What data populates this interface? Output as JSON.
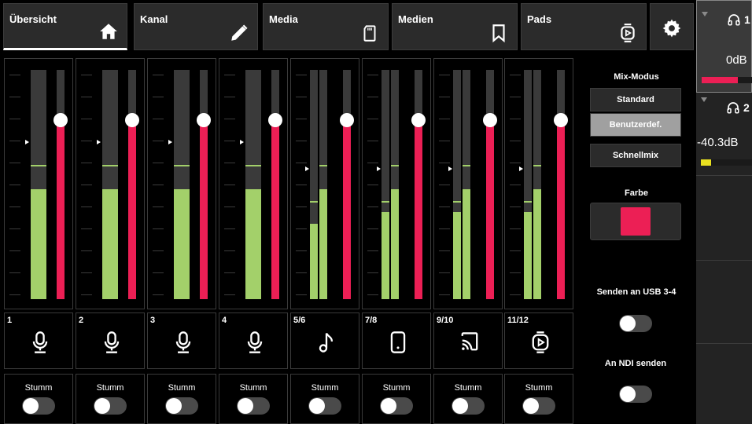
{
  "tabs": [
    {
      "label": "Übersicht",
      "icon": "home-icon"
    },
    {
      "label": "Kanal",
      "icon": "pencil-icon"
    },
    {
      "label": "Media",
      "icon": "sd-card-icon"
    },
    {
      "label": "Medien",
      "icon": "bookmark-icon"
    },
    {
      "label": "Pads",
      "icon": "sampler-pad-icon"
    }
  ],
  "settings_icon": "gear-icon",
  "channels": [
    {
      "number": "1",
      "icon": "microphone-icon",
      "mute_label": "Stumm",
      "meter_levels": [
        0.48
      ],
      "peak_levels": [
        0.58
      ],
      "fader_level": 0.78,
      "muted": false
    },
    {
      "number": "2",
      "icon": "microphone-icon",
      "mute_label": "Stumm",
      "meter_levels": [
        0.48
      ],
      "peak_levels": [
        0.58
      ],
      "fader_level": 0.78,
      "muted": false
    },
    {
      "number": "3",
      "icon": "microphone-icon",
      "mute_label": "Stumm",
      "meter_levels": [
        0.48
      ],
      "peak_levels": [
        0.58
      ],
      "fader_level": 0.78,
      "muted": false
    },
    {
      "number": "4",
      "icon": "microphone-icon",
      "mute_label": "Stumm",
      "meter_levels": [
        0.48
      ],
      "peak_levels": [
        0.58
      ],
      "fader_level": 0.78,
      "muted": false
    },
    {
      "number": "5/6",
      "icon": "music-note-icon",
      "mute_label": "Stumm",
      "meter_levels": [
        0.33,
        0.48
      ],
      "peak_levels": [
        0.42,
        0.58
      ],
      "fader_level": 0.78,
      "muted": false
    },
    {
      "number": "7/8",
      "icon": "phone-icon",
      "mute_label": "Stumm",
      "meter_levels": [
        0.38,
        0.48
      ],
      "peak_levels": [
        0.42,
        0.58
      ],
      "fader_level": 0.78,
      "muted": false
    },
    {
      "number": "9/10",
      "icon": "cast-icon",
      "mute_label": "Stumm",
      "meter_levels": [
        0.38,
        0.48
      ],
      "peak_levels": [
        0.42,
        0.58
      ],
      "fader_level": 0.78,
      "muted": false
    },
    {
      "number": "11/12",
      "icon": "sampler-pad-icon",
      "mute_label": "Stumm",
      "meter_levels": [
        0.38,
        0.48
      ],
      "peak_levels": [
        0.42,
        0.58
      ],
      "fader_level": 0.78,
      "muted": false
    }
  ],
  "control_panel": {
    "mix_mode_title": "Mix-Modus",
    "modes": [
      "Standard",
      "Benutzerdef.",
      "Schnellmix"
    ],
    "selected_mode": "Benutzerdef.",
    "color_title": "Farbe",
    "color_value": "#ec1f55",
    "usb_send_title": "Senden an USB 3-4",
    "usb_send_on": false,
    "ndi_send_title": "An NDI senden",
    "ndi_send_on": false
  },
  "outputs": [
    {
      "index": "1",
      "icon": "headphones-icon",
      "level": "0dB",
      "meter": 0.7,
      "meter_color": "#ec1f55"
    },
    {
      "index": "2",
      "icon": "headphones-icon",
      "level": "-40.3dB",
      "meter": 0.2,
      "meter_color": "#e8e020"
    }
  ],
  "colors": {
    "meter_green": "#a3d06a",
    "fader_red": "#ec1f55",
    "panel_gray": "#2b2b2b"
  }
}
